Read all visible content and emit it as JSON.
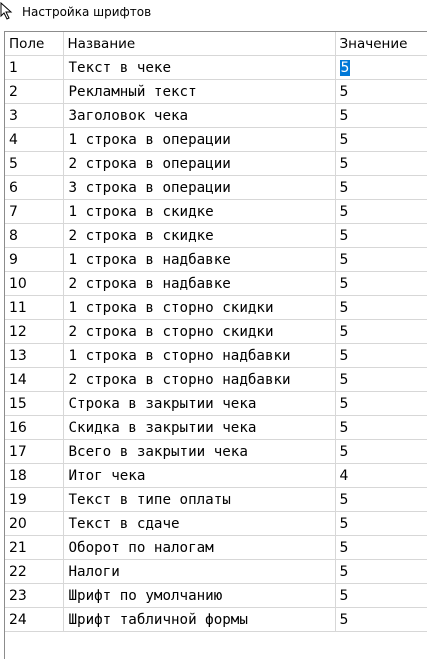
{
  "window": {
    "title": "Настройка шрифтов"
  },
  "grid": {
    "headers": {
      "field": "Поле",
      "name": "Название",
      "value": "Значение"
    },
    "rows": [
      {
        "field": "1",
        "name": "Текст в чеке",
        "value": "5",
        "selected": true
      },
      {
        "field": "2",
        "name": "Рекламный текст",
        "value": "5"
      },
      {
        "field": "3",
        "name": "Заголовок чека",
        "value": "5"
      },
      {
        "field": "4",
        "name": "1 строка в операции",
        "value": "5"
      },
      {
        "field": "5",
        "name": "2 строка в операции",
        "value": "5"
      },
      {
        "field": "6",
        "name": "3 строка в операции",
        "value": "5"
      },
      {
        "field": "7",
        "name": "1 строка в скидке",
        "value": "5"
      },
      {
        "field": "8",
        "name": "2 строка в скидке",
        "value": "5"
      },
      {
        "field": "9",
        "name": "1 строка в надбавке",
        "value": "5"
      },
      {
        "field": "10",
        "name": "2 строка в надбавке",
        "value": "5"
      },
      {
        "field": "11",
        "name": "1 строка в сторно скидки",
        "value": "5"
      },
      {
        "field": "12",
        "name": "2 строка в сторно скидки",
        "value": "5"
      },
      {
        "field": "13",
        "name": "1 строка в сторно надбавки",
        "value": "5"
      },
      {
        "field": "14",
        "name": "2 строка в сторно надбавки",
        "value": "5"
      },
      {
        "field": "15",
        "name": "Строка в закрытии чека",
        "value": "5"
      },
      {
        "field": "16",
        "name": "Скидка в закрытии чека",
        "value": "5"
      },
      {
        "field": "17",
        "name": "Всего в закрытии чека",
        "value": "5"
      },
      {
        "field": "18",
        "name": "Итог чека",
        "value": "4"
      },
      {
        "field": "19",
        "name": "Текст в типе оплаты",
        "value": "5"
      },
      {
        "field": "20",
        "name": "Текст в сдаче",
        "value": "5"
      },
      {
        "field": "21",
        "name": "Оборот по налогам",
        "value": "5"
      },
      {
        "field": "22",
        "name": "Налоги",
        "value": "5"
      },
      {
        "field": "23",
        "name": "Шрифт по умолчанию",
        "value": "5"
      },
      {
        "field": "24",
        "name": "Шрифт табличной формы",
        "value": "5"
      }
    ]
  },
  "colors": {
    "selection": "#0078d7",
    "gridline": "#d7d7d7"
  }
}
